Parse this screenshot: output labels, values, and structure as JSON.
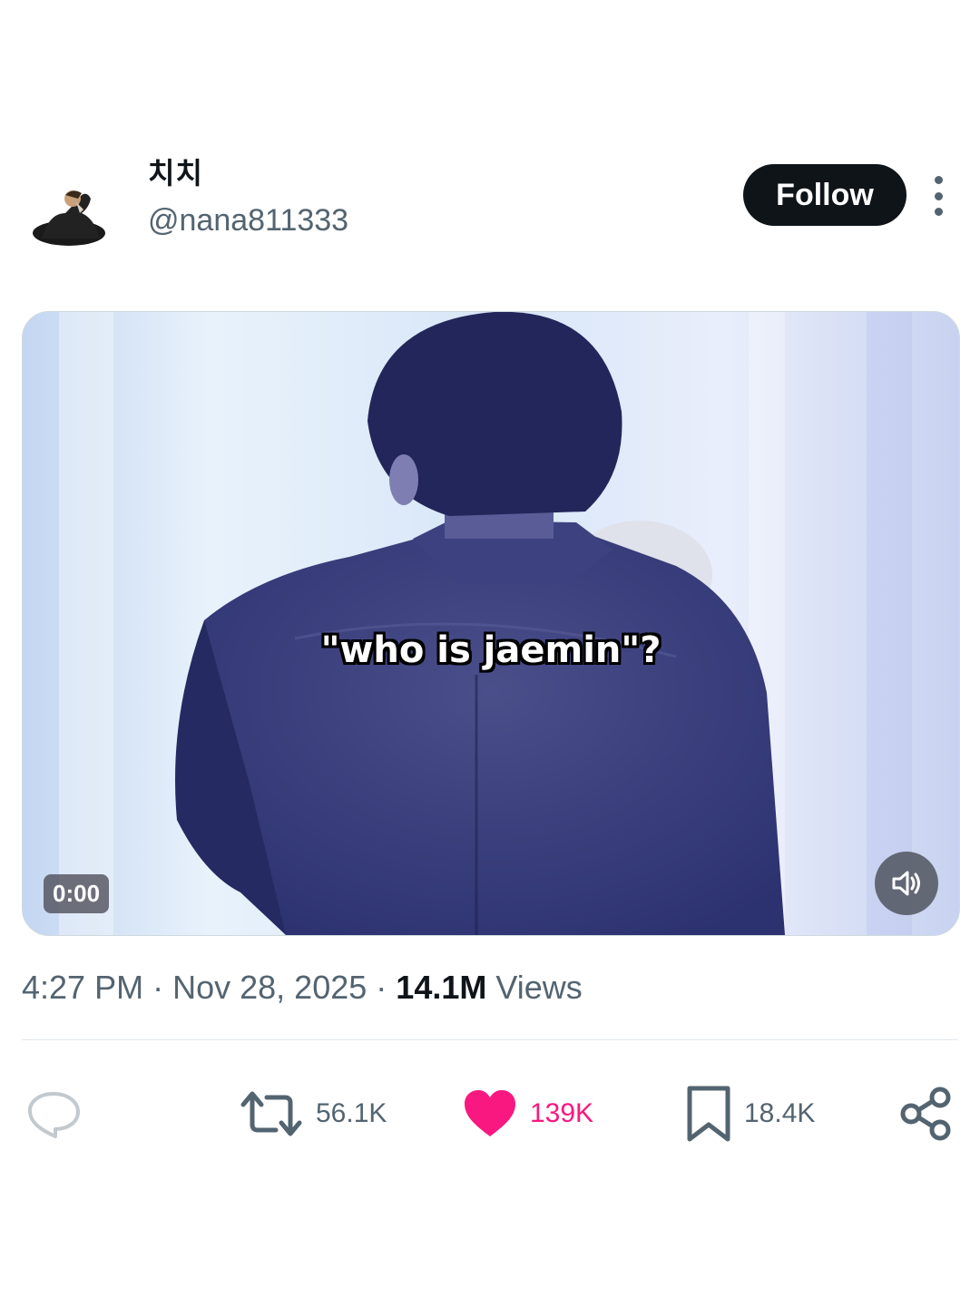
{
  "author": {
    "display_name": "치치",
    "handle": "@nana811333",
    "avatar_icon": "profile-photo"
  },
  "header": {
    "follow_label": "Follow",
    "more_icon": "more-vertical-icon"
  },
  "media": {
    "caption": "\"who is jaemin\"?",
    "timecode": "0:00",
    "volume_icon": "speaker-icon"
  },
  "meta": {
    "time": "4:27 PM",
    "separator": "·",
    "date": "Nov 28, 2025",
    "views_count": "14.1M",
    "views_label": "Views"
  },
  "actions": {
    "reply": {
      "icon": "reply-bubble-icon"
    },
    "repost": {
      "icon": "repost-icon",
      "count": "56.1K"
    },
    "like": {
      "icon": "heart-icon",
      "count": "139K",
      "liked": true
    },
    "bookmark": {
      "icon": "bookmark-icon",
      "count": "18.4K"
    },
    "share": {
      "icon": "share-icon"
    }
  },
  "colors": {
    "text_primary": "#0f1419",
    "text_secondary": "#536471",
    "like_active": "#f91880",
    "follow_bg": "#0f1419"
  }
}
